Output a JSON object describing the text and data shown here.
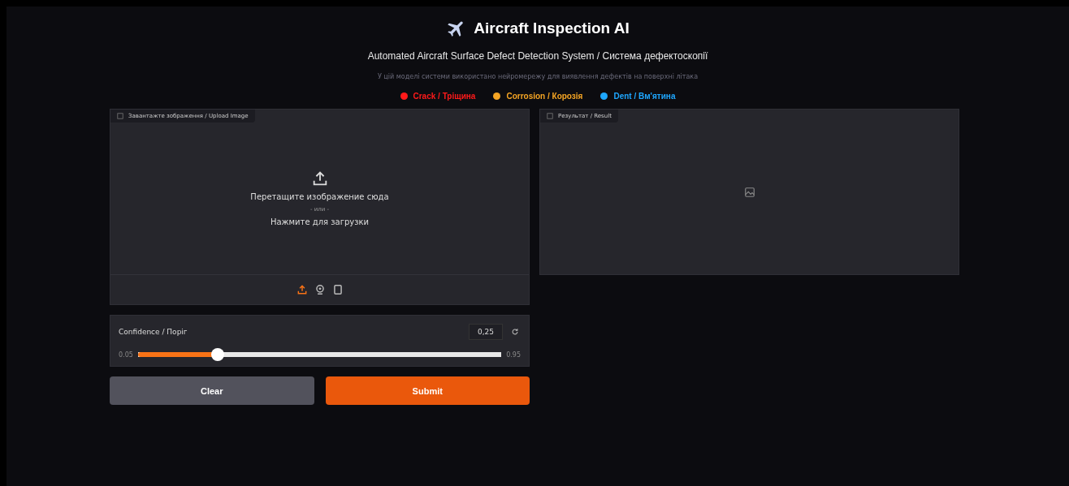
{
  "header": {
    "title": "Aircraft Inspection AI",
    "subtitle": "Automated Aircraft Surface Defect Detection System / Система дефектоскопії",
    "description": "У цій моделі системи використано нейромережу для виявлення дефектів на поверхні літака"
  },
  "legend": [
    {
      "label": "Crack / Тріщина",
      "color": "#ff1a1a"
    },
    {
      "label": "Corrosion / Корозія",
      "color": "#f5a524"
    },
    {
      "label": "Dent / Вм'ятина",
      "color": "#1ea7ff"
    }
  ],
  "upload": {
    "label": "Завантажте зображення / Upload Image",
    "drop_text": "Перетащите изображение сюда",
    "or_text": "- или -",
    "click_text": "Нажмите для загрузки",
    "sources": [
      {
        "kind": "upload",
        "selected": true
      },
      {
        "kind": "webcam",
        "selected": false
      },
      {
        "kind": "clipboard",
        "selected": false
      }
    ]
  },
  "slider": {
    "label": "Confidence / Поріг",
    "value": "0,25",
    "min_label": "0.05",
    "max_label": "0.95",
    "level": 0.22
  },
  "buttons": [
    {
      "label": "Clear",
      "kind": "secondary"
    },
    {
      "label": "Submit",
      "kind": "primary"
    }
  ],
  "result": {
    "label": "Результат / Result"
  }
}
